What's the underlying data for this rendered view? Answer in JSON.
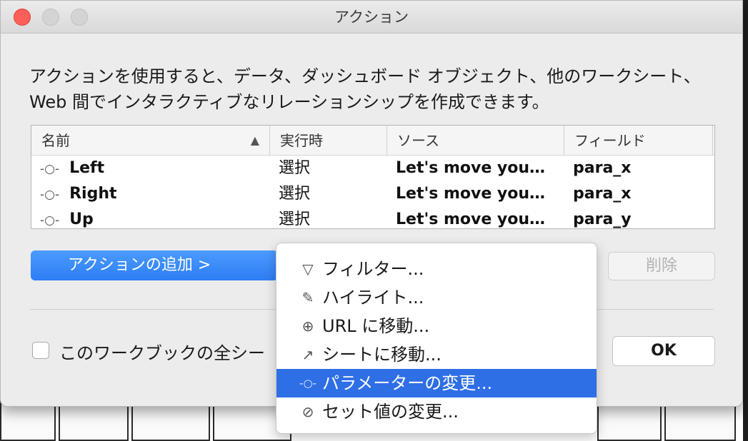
{
  "window": {
    "title": "アクション"
  },
  "description": "アクションを使用すると、データ、ダッシュボード オブジェクト、他のワークシート、Web 間でインタラクティブなリレーションシップを作成できます。",
  "table": {
    "columns": [
      "名前",
      "実行時",
      "ソース",
      "フィールド"
    ],
    "sort_indicator": "▲",
    "rows": [
      {
        "icon": "-○-",
        "name": "Left",
        "trigger": "選択",
        "source": "Let's move you…",
        "field": "para_x"
      },
      {
        "icon": "-○-",
        "name": "Right",
        "trigger": "選択",
        "source": "Let's move you…",
        "field": "para_x"
      },
      {
        "icon": "-○-",
        "name": "Up",
        "trigger": "選択",
        "source": "Let's move you…",
        "field": "para_y"
      }
    ]
  },
  "buttons": {
    "add_action": "アクションの追加 >",
    "delete": "削除",
    "ok": "OK"
  },
  "checkbox": {
    "label": "このワークブックの全シー",
    "checked": false
  },
  "menu": {
    "items": [
      {
        "icon": "filter-icon",
        "glyph": "▽",
        "label": "フィルター..."
      },
      {
        "icon": "highlight-icon",
        "glyph": "✎",
        "label": "ハイライト..."
      },
      {
        "icon": "globe-icon",
        "glyph": "⊕",
        "label": "URL に移動..."
      },
      {
        "icon": "external-link-icon",
        "glyph": "↗",
        "label": "シートに移動..."
      },
      {
        "icon": "parameter-icon",
        "glyph": "-○-",
        "label": "パラメーターの変更...",
        "selected": true
      },
      {
        "icon": "set-icon",
        "glyph": "⊘",
        "label": "セット値の変更..."
      }
    ]
  },
  "colors": {
    "accent": "#2e6fe6",
    "close": "#fe5f57",
    "dialog_bg": "#ececec"
  }
}
